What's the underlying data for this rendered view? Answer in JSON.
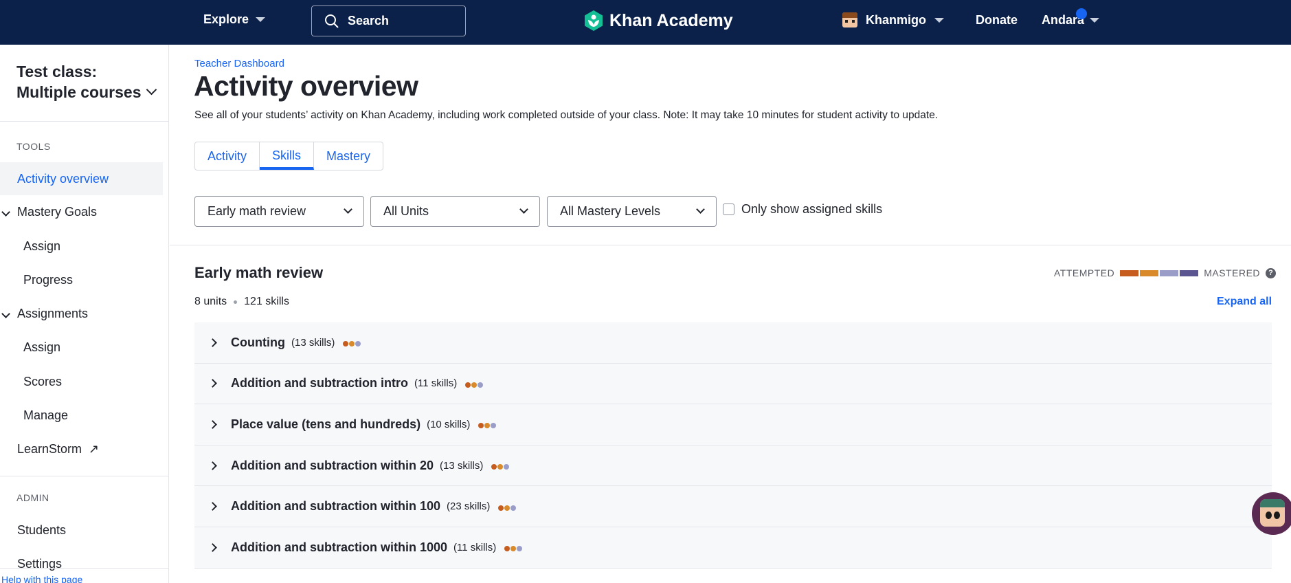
{
  "topnav": {
    "explore_label": "Explore",
    "search_label": "Search",
    "logo_text": "Khan Academy",
    "khanmigo_label": "Khanmigo",
    "donate_label": "Donate",
    "user_label": "Andara"
  },
  "sidebar": {
    "class_title": "Test class: Multiple courses",
    "tools_heading": "TOOLS",
    "activity_overview": "Activity overview",
    "mastery_goals": "Mastery Goals",
    "mastery_assign": "Assign",
    "mastery_progress": "Progress",
    "assignments": "Assignments",
    "assign_assign": "Assign",
    "assign_scores": "Scores",
    "assign_manage": "Manage",
    "learnstorm": "LearnStorm",
    "admin_heading": "ADMIN",
    "students": "Students",
    "settings": "Settings",
    "help_link": "Help with this page"
  },
  "main": {
    "breadcrumb": "Teacher Dashboard",
    "title": "Activity overview",
    "description": "See all of your students’ activity on Khan Academy, including work completed outside of your class. Note: It may take 10 minutes for student activity to update.",
    "tabs": [
      "Activity",
      "Skills",
      "Mastery"
    ],
    "active_tab": "Skills",
    "filters": {
      "course": "Early math review",
      "units": "All Units",
      "mastery": "All Mastery Levels",
      "only_assigned_label": "Only show assigned skills"
    },
    "section_title": "Early math review",
    "units_count": "8 units",
    "skills_count": "121 skills",
    "legend_left": "ATTEMPTED",
    "legend_right": "MASTERED",
    "legend_help": "?",
    "legend_colors": [
      "#c65c1e",
      "#d98a2b",
      "#9b9dc9",
      "#5b5592"
    ],
    "expand_all": "Expand all",
    "units": [
      {
        "name": "Counting",
        "count": "(13 skills)"
      },
      {
        "name": "Addition and subtraction intro",
        "count": "(11 skills)"
      },
      {
        "name": "Place value (tens and hundreds)",
        "count": "(10 skills)"
      },
      {
        "name": "Addition and subtraction within 20",
        "count": "(13 skills)"
      },
      {
        "name": "Addition and subtraction within 100",
        "count": "(23 skills)"
      },
      {
        "name": "Addition and subtraction within 1000",
        "count": "(11 skills)"
      }
    ],
    "dot_colors": [
      "#c65c1e",
      "#d98a2b",
      "#9b9dc9"
    ]
  }
}
